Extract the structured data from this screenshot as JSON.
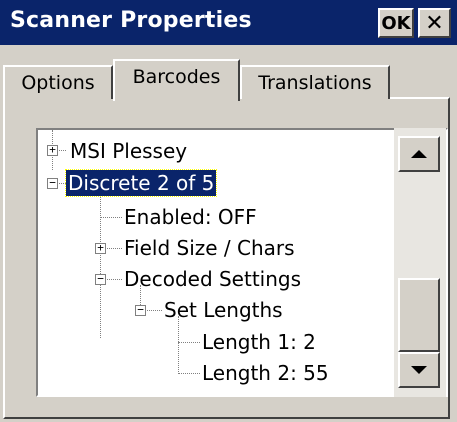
{
  "window": {
    "title": "Scanner Properties",
    "ok_label": "OK",
    "close_glyph": "✕"
  },
  "tabs": [
    {
      "label": "Options",
      "selected": false
    },
    {
      "label": "Barcodes",
      "selected": true
    },
    {
      "label": "Translations",
      "selected": false
    }
  ],
  "tree": {
    "nodes": [
      {
        "label": "MSI Plessey",
        "expander": "+"
      },
      {
        "label": "Discrete 2 of 5",
        "expander": "−",
        "selected": true
      },
      {
        "label": "Enabled: OFF"
      },
      {
        "label": "Field Size / Chars",
        "expander": "+"
      },
      {
        "label": "Decoded Settings",
        "expander": "−"
      },
      {
        "label": "Set Lengths",
        "expander": "−"
      },
      {
        "label": "Length 1: 2"
      },
      {
        "label": "Length 2: 55"
      }
    ]
  },
  "scrollbar": {
    "up_icon": "scroll-up-arrow-icon",
    "down_icon": "scroll-down-arrow-icon",
    "position": "bottom"
  },
  "colors": {
    "titlebar": "#0a246a",
    "selection": "#0a246a",
    "face": "#d4d0c8"
  }
}
